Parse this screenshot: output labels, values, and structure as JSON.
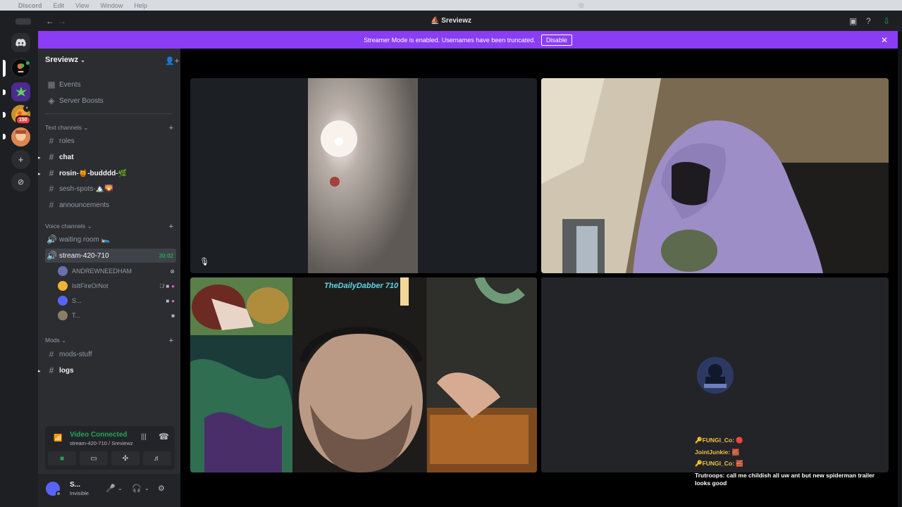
{
  "menubar": {
    "app": "Discord",
    "items": [
      "Edit",
      "View",
      "Window",
      "Help"
    ]
  },
  "window": {
    "title": "Sreviewz"
  },
  "banner": {
    "text": "Streamer Mode is enabled. Usernames have been truncated.",
    "button": "Disable"
  },
  "guild_badge": "150",
  "server": {
    "name": "Sreviewz"
  },
  "top_items": [
    {
      "label": "Events"
    },
    {
      "label": "Server Boosts"
    }
  ],
  "categories": {
    "text": "Text channels",
    "voice": "Voice channels",
    "mods": "Mods"
  },
  "text_channels": [
    "roles",
    "chat",
    "rosin-🍯-budddd-🌿",
    "sesh-spots-🏔️🌄",
    "announcements"
  ],
  "voice_channels": {
    "waiting": "waiting room 🛌",
    "stream": "stream-420-710",
    "timer": "30:02"
  },
  "voice_users": [
    "ANDREWNEEDHAM",
    "IsItFireOrNot",
    "S...",
    "T..."
  ],
  "mod_channels": [
    "mods-stuff",
    "logs"
  ],
  "voice_panel": {
    "title": "Video Connected",
    "subtitle": "stream-420-710 / Sreviewz"
  },
  "user": {
    "name": "S...",
    "status": "Invisible"
  },
  "overlay": {
    "text": "TheDailyDabber 710"
  },
  "chat": [
    {
      "user": "🔑FUNGI_Co:",
      "text": "🔴"
    },
    {
      "user": "JointJunkie:",
      "text": "🧱"
    },
    {
      "user": "🔑FUNGI_Co:",
      "text": "🧱"
    },
    {
      "user": "Trutroops:",
      "text": "call me childish all uw ant but new spiderman trailer looks good"
    }
  ],
  "colors": {
    "accent": "#8b3cf5",
    "connected": "#23a55a",
    "sidebar": "#2b2d31"
  }
}
